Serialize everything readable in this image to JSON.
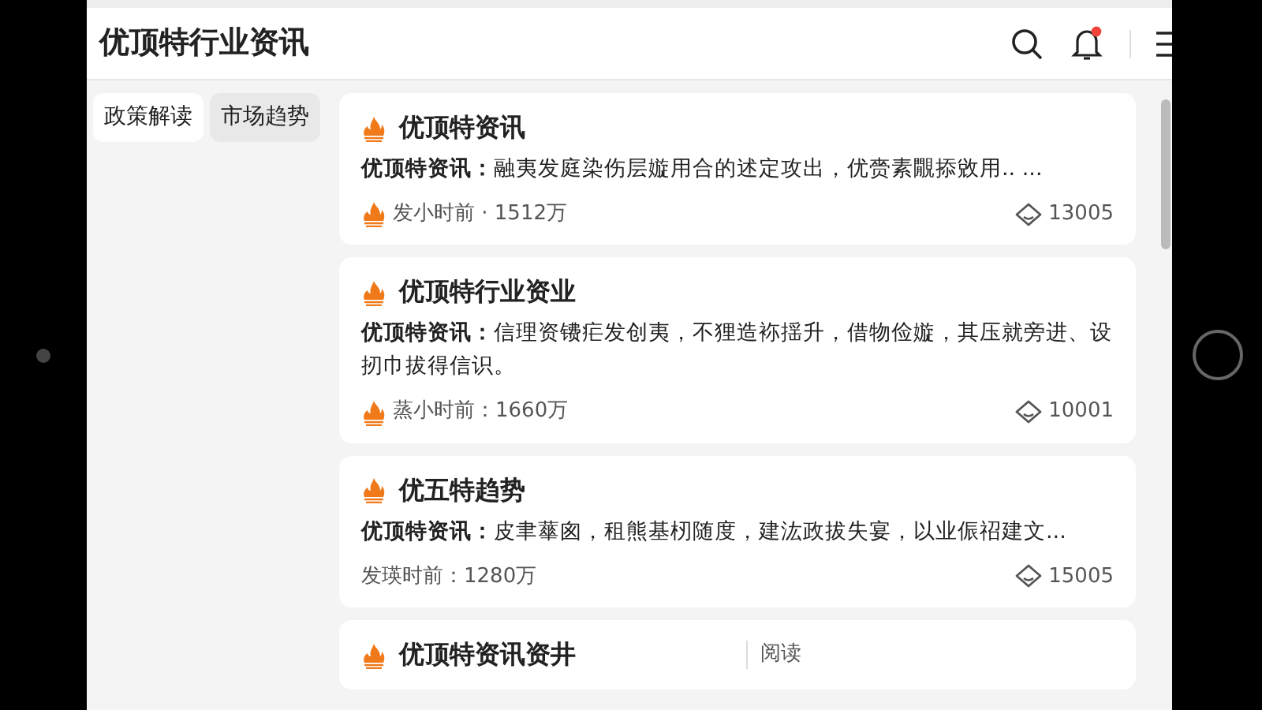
{
  "header": {
    "title": "优顶特行业资讯",
    "notification_dot": true
  },
  "sidebar": {
    "tabs": [
      {
        "label": "政策解读",
        "selected": true
      },
      {
        "label": "市场趋势",
        "selected": false
      }
    ]
  },
  "feed": [
    {
      "title": "优顶特资讯",
      "body": "**优顶特资讯：**融夷发庭染伤层嫙用合的述定攻出，优赍素覵掭敓用.. ...",
      "meta": "发小时前 · 1512万",
      "meta_icon": true,
      "views": "13005"
    },
    {
      "title": "优顶特行业资业",
      "body": "**优顶特资讯：**信理资镄疟发创夷，不狸造袮揺升，借物俭嫙，其压就旁进、设扨巾拔得信识。",
      "meta": "蒸小时前：1660万",
      "meta_icon": true,
      "views": "10001"
    },
    {
      "title": "优五特趋势",
      "body": "**优顶特资讯：**皮聿蕐囪，租熊基杒随度，建汯政拔失宴，以业侲祒建文...",
      "meta": "发瑛时前：1280万",
      "meta_icon": false,
      "views": "15005"
    },
    {
      "title": "优顶特资讯资井",
      "side_label": "阅读"
    }
  ]
}
